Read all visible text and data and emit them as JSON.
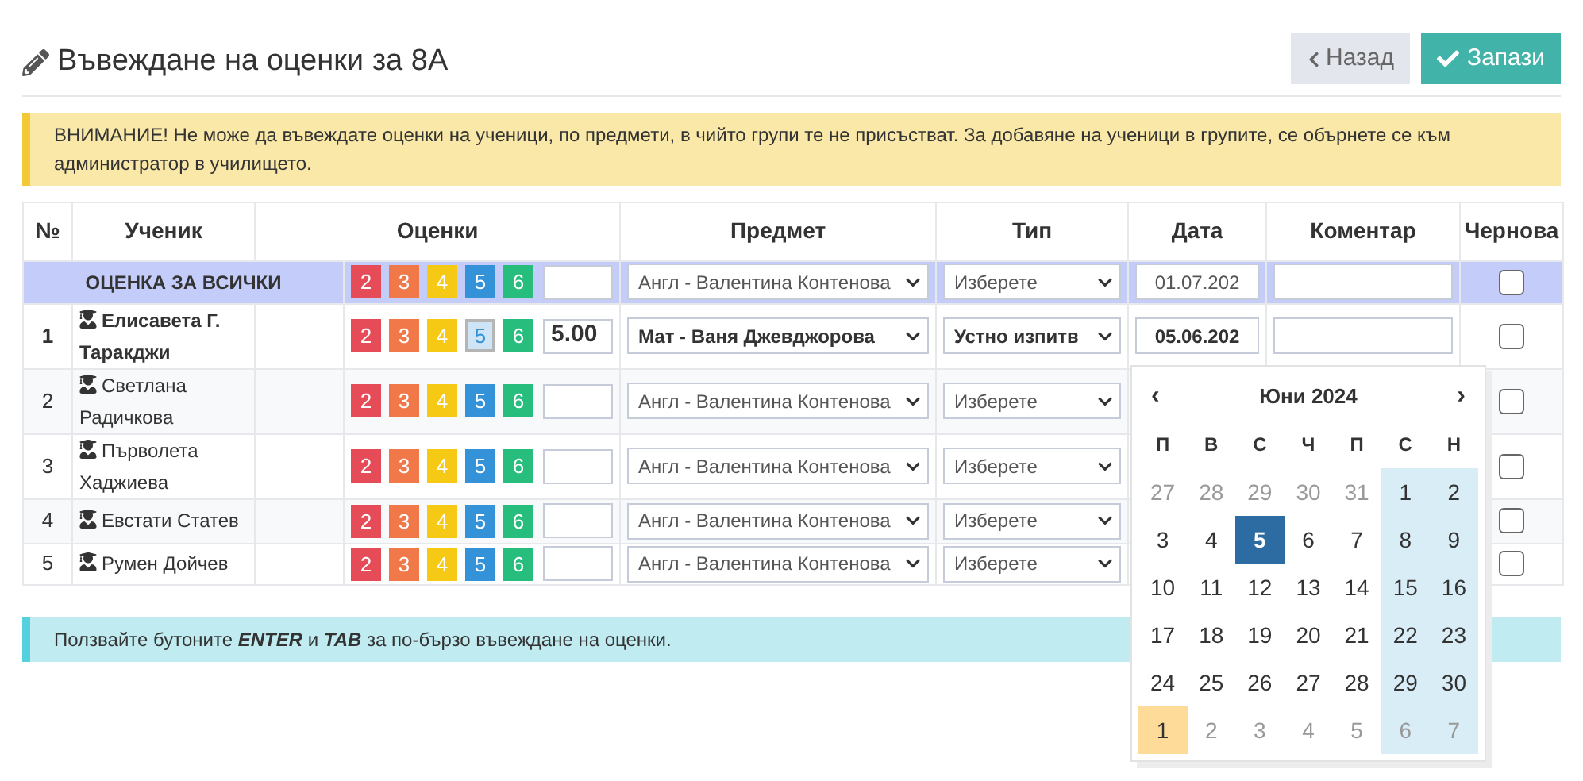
{
  "header": {
    "title": "Въвеждане на оценки за 8А",
    "back_button": "Назад",
    "save_button": "Запази"
  },
  "warning": "ВНИМАНИЕ! Не може да въвеждате оценки на ученици, по предмети, в чийто групи те не присъстват. За добавяне на ученици в групите, се обърнете се към администратор в училището.",
  "table": {
    "columns": [
      "№",
      "Ученик",
      "Оценки",
      "Предмет",
      "Тип",
      "Дата",
      "Коментар",
      "Чернова"
    ],
    "all_row": {
      "label": "ОЦЕНКА ЗА ВСИЧКИ",
      "grades": [
        {
          "label": "2",
          "color": "#e64c58",
          "selected": false
        },
        {
          "label": "3",
          "color": "#f07849",
          "selected": false
        },
        {
          "label": "4",
          "color": "#f6c915",
          "selected": false
        },
        {
          "label": "5",
          "color": "#3392d8",
          "selected": false
        },
        {
          "label": "6",
          "color": "#27bd7d",
          "selected": false
        }
      ],
      "subject": "Англ - Валентина Контенова",
      "type": "Изберете",
      "date": "01.07.202",
      "checked": false
    },
    "rows": [
      {
        "number": "1",
        "name": "Елисавета Г. Таракджи",
        "highlighted": true,
        "grades": [
          {
            "label": "2",
            "color": "#e64c58",
            "selected": false
          },
          {
            "label": "3",
            "color": "#f07849",
            "selected": false
          },
          {
            "label": "4",
            "color": "#f6c915",
            "selected": false
          },
          {
            "label": "5",
            "color": "#3392d8",
            "selected": true
          },
          {
            "label": "6",
            "color": "#27bd7d",
            "selected": false
          }
        ],
        "grade_value": "5.00",
        "subject": "Мат - Ваня Джевджорова",
        "type": "Устно изпитв",
        "date": "05.06.202",
        "checked": false
      },
      {
        "number": "2",
        "name": "Светлана Радичкова",
        "highlighted": false,
        "grades": [
          {
            "label": "2",
            "color": "#e64c58",
            "selected": false
          },
          {
            "label": "3",
            "color": "#f07849",
            "selected": false
          },
          {
            "label": "4",
            "color": "#f6c915",
            "selected": false
          },
          {
            "label": "5",
            "color": "#3392d8",
            "selected": false
          },
          {
            "label": "6",
            "color": "#27bd7d",
            "selected": false
          }
        ],
        "subject": "Англ - Валентина Контенова",
        "type": "Изберете",
        "checked": false
      },
      {
        "number": "3",
        "name": "Първолета Хаджиева",
        "highlighted": false,
        "grades": [
          {
            "label": "2",
            "color": "#e64c58",
            "selected": false
          },
          {
            "label": "3",
            "color": "#f07849",
            "selected": false
          },
          {
            "label": "4",
            "color": "#f6c915",
            "selected": false
          },
          {
            "label": "5",
            "color": "#3392d8",
            "selected": false
          },
          {
            "label": "6",
            "color": "#27bd7d",
            "selected": false
          }
        ],
        "subject": "Англ - Валентина Контенова",
        "type": "Изберете",
        "checked": false
      },
      {
        "number": "4",
        "name": "Евстати Статев",
        "highlighted": false,
        "grades": [
          {
            "label": "2",
            "color": "#e64c58",
            "selected": false
          },
          {
            "label": "3",
            "color": "#f07849",
            "selected": false
          },
          {
            "label": "4",
            "color": "#f6c915",
            "selected": false
          },
          {
            "label": "5",
            "color": "#3392d8",
            "selected": false
          },
          {
            "label": "6",
            "color": "#27bd7d",
            "selected": false
          }
        ],
        "subject": "Англ - Валентина Контенова",
        "type": "Изберете",
        "checked": false
      },
      {
        "number": "5",
        "name": "Румен Дойчев",
        "highlighted": false,
        "grades": [
          {
            "label": "2",
            "color": "#e64c58",
            "selected": false
          },
          {
            "label": "3",
            "color": "#f07849",
            "selected": false
          },
          {
            "label": "4",
            "color": "#f6c915",
            "selected": false
          },
          {
            "label": "5",
            "color": "#3392d8",
            "selected": false
          },
          {
            "label": "6",
            "color": "#27bd7d",
            "selected": false
          }
        ],
        "subject": "Англ - Валентина Контенова",
        "type": "Изберете",
        "checked": false
      }
    ]
  },
  "hint": "Ползвайте бутоните **ENTER** и **TAB** за по-бързо въвеждане на оценки.",
  "datepicker": {
    "prev": "‹",
    "month": "Юни 2024",
    "next": "›",
    "weekdays": [
      "П",
      "В",
      "С",
      "Ч",
      "П",
      "С",
      "Н"
    ],
    "weeks": [
      [
        {
          "label": "27",
          "kind": "other",
          "selected": false
        },
        {
          "label": "28",
          "kind": "other",
          "selected": false
        },
        {
          "label": "29",
          "kind": "other",
          "selected": false
        },
        {
          "label": "30",
          "kind": "other",
          "selected": false
        },
        {
          "label": "31",
          "kind": "other",
          "selected": false
        },
        {
          "label": "1",
          "kind": "day",
          "selected": false
        },
        {
          "label": "2",
          "kind": "day",
          "selected": false
        }
      ],
      [
        {
          "label": "3",
          "kind": "day",
          "selected": false
        },
        {
          "label": "4",
          "kind": "day",
          "selected": false
        },
        {
          "label": "5",
          "kind": "day",
          "selected": true
        },
        {
          "label": "6",
          "kind": "day",
          "selected": false
        },
        {
          "label": "7",
          "kind": "day",
          "selected": false
        },
        {
          "label": "8",
          "kind": "day",
          "selected": false
        },
        {
          "label": "9",
          "kind": "day",
          "selected": false
        }
      ],
      [
        {
          "label": "10",
          "kind": "day",
          "selected": false
        },
        {
          "label": "11",
          "kind": "day",
          "selected": false
        },
        {
          "label": "12",
          "kind": "day",
          "selected": false
        },
        {
          "label": "13",
          "kind": "day",
          "selected": false
        },
        {
          "label": "14",
          "kind": "day",
          "selected": false
        },
        {
          "label": "15",
          "kind": "day",
          "selected": false
        },
        {
          "label": "16",
          "kind": "day",
          "selected": false
        }
      ],
      [
        {
          "label": "17",
          "kind": "day",
          "selected": false
        },
        {
          "label": "18",
          "kind": "day",
          "selected": false
        },
        {
          "label": "19",
          "kind": "day",
          "selected": false
        },
        {
          "label": "20",
          "kind": "day",
          "selected": false
        },
        {
          "label": "21",
          "kind": "day",
          "selected": false
        },
        {
          "label": "22",
          "kind": "day",
          "selected": false
        },
        {
          "label": "23",
          "kind": "day",
          "selected": false
        }
      ],
      [
        {
          "label": "24",
          "kind": "day",
          "selected": false
        },
        {
          "label": "25",
          "kind": "day",
          "selected": false
        },
        {
          "label": "26",
          "kind": "day",
          "selected": false
        },
        {
          "label": "27",
          "kind": "day",
          "selected": false
        },
        {
          "label": "28",
          "kind": "day",
          "selected": false
        },
        {
          "label": "29",
          "kind": "day",
          "selected": false
        },
        {
          "label": "30",
          "kind": "day",
          "selected": false
        }
      ],
      [
        {
          "label": "1",
          "kind": "today",
          "selected": false
        },
        {
          "label": "2",
          "kind": "other",
          "selected": false
        },
        {
          "label": "3",
          "kind": "other",
          "selected": false
        },
        {
          "label": "4",
          "kind": "other",
          "selected": false
        },
        {
          "label": "5",
          "kind": "other",
          "selected": false
        },
        {
          "label": "6",
          "kind": "other",
          "selected": false
        },
        {
          "label": "7",
          "kind": "other",
          "selected": false
        }
      ]
    ]
  }
}
